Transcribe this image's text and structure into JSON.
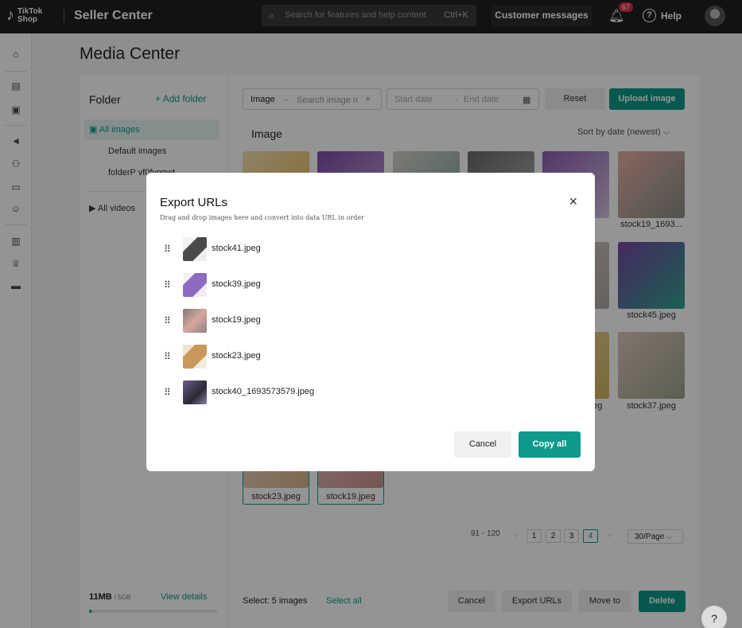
{
  "app": {
    "logo_line1": "TikTok",
    "logo_line2": "Shop",
    "brand": "Seller Center"
  },
  "header": {
    "search_placeholder": "Search for features and help content",
    "search_shortcut": "Ctrl+K",
    "customer_messages": "Customer messages",
    "notification_count": "67",
    "help_label": "Help"
  },
  "page": {
    "title": "Media Center"
  },
  "folders": {
    "title": "Folder",
    "add_label": "Add folder",
    "items": [
      {
        "label": "All images"
      },
      {
        "label": "Default images"
      },
      {
        "label": "folderP yf0fvggwt"
      }
    ],
    "videos_label": "All videos",
    "storage_used": "11MB",
    "storage_total": "/ 5GB",
    "storage_fraction": 0.01,
    "view_details": "View details"
  },
  "toolbar": {
    "type_value": "Image",
    "search_placeholder": "Search image n",
    "start_date": "Start date",
    "date_sep": "-",
    "end_date": "End date",
    "reset": "Reset",
    "upload": "Upload image"
  },
  "gallery": {
    "title": "Image",
    "sort_label": "Sort by date (newest)",
    "labels": {
      "stock19_1693": "stock19_1693...",
      "stock45": "stock45.jpeg",
      "stock37": "stock37.jpeg",
      "stock23": "stock23.jpeg",
      "stock19": "stock19.jpeg",
      "partial_dot1": "...",
      "partial_dot2": "...",
      "partial_jpg1": "jpeg",
      "partial_jpg2": "jpeg"
    }
  },
  "pagination": {
    "range": "91 - 120",
    "pages": [
      "1",
      "2",
      "3",
      "4"
    ],
    "current": "4",
    "per_page": "30/Page"
  },
  "footer": {
    "select_count": "Select: 5 images",
    "select_all": "Select all",
    "cancel": "Cancel",
    "export_urls": "Export URLs",
    "move_to": "Move to",
    "delete": "Delete"
  },
  "modal": {
    "title": "Export URLs",
    "subtitle": "Drag and drop images here and convert into data URL in order",
    "rows": [
      {
        "filename": "stock41.jpeg"
      },
      {
        "filename": "stock39.jpeg"
      },
      {
        "filename": "stock19.jpeg"
      },
      {
        "filename": "stock23.jpeg"
      },
      {
        "filename": "stock40_1693573579.jpeg"
      }
    ],
    "cancel": "Cancel",
    "copy_all": "Copy all"
  },
  "colors": {
    "accent": "#0d9a8b",
    "topbar": "#1f1f1f",
    "badge": "#e02d45"
  }
}
